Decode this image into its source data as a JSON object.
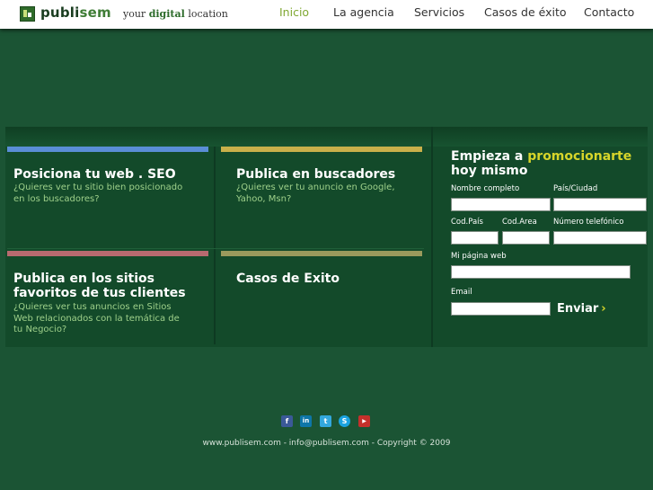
{
  "header": {
    "brand_part1": "publi",
    "brand_part2": "sem",
    "tagline_before": "your",
    "tagline_highlight": "digital",
    "tagline_after": "location",
    "nav": [
      {
        "label": "Inicio",
        "active": true
      },
      {
        "label": "La agencia",
        "active": false
      },
      {
        "label": "Servicios",
        "active": false
      },
      {
        "label": "Casos de éxito",
        "active": false
      },
      {
        "label": "Contacto",
        "active": false
      }
    ]
  },
  "boxes": [
    {
      "title": "Posiciona tu web . SEO",
      "subtitle": "¿Quieres ver tu sitio bien posicionado en los buscadores?",
      "stripe_color": "#5a8ed6"
    },
    {
      "title": "Publica en buscadores",
      "subtitle": "¿Quieres ver tu anuncio en Google, Yahoo, Msn?",
      "stripe_color": "#c9b04a"
    },
    {
      "title": "Publica en los sitios favoritos de tus clientes",
      "subtitle": "¿Quieres ver tus anuncios en Sitios Web relacionados con la temática de tu Negocio?",
      "stripe_color": "#b86a6f"
    },
    {
      "title": "Casos de Exito",
      "subtitle": "",
      "stripe_color": "#9a9a5c"
    }
  ],
  "form": {
    "title_before": "Empieza a",
    "title_highlight": "promocionarte",
    "title_after": "hoy mismo",
    "labels": {
      "nombre": "Nombre completo",
      "pais_ciudad": "País/Ciudad",
      "cod_pais": "Cod.País",
      "cod_area": "Cod.Area",
      "telefono": "Número telefónico",
      "pagina_web": "Mi página web",
      "email": "Email"
    },
    "values": {
      "nombre": "",
      "pais_ciudad": "",
      "cod_pais": "",
      "cod_area": "",
      "telefono": "",
      "pagina_web": "",
      "email": ""
    },
    "submit_label": "Enviar",
    "submit_arrow": "›"
  },
  "social": [
    {
      "name": "facebook-icon",
      "glyph": "f",
      "color": "#3b5998"
    },
    {
      "name": "linkedin-icon",
      "glyph": "in",
      "color": "#0e76a8"
    },
    {
      "name": "twitter-icon",
      "glyph": "t",
      "color": "#33a8dd"
    },
    {
      "name": "skype-icon",
      "glyph": "S",
      "color": "#1ba3e0"
    },
    {
      "name": "youtube-icon",
      "glyph": "▶",
      "color": "#c4302b"
    }
  ],
  "footer": {
    "text": "www.publisem.com - info@publisem.com - Copyright © 2009"
  }
}
